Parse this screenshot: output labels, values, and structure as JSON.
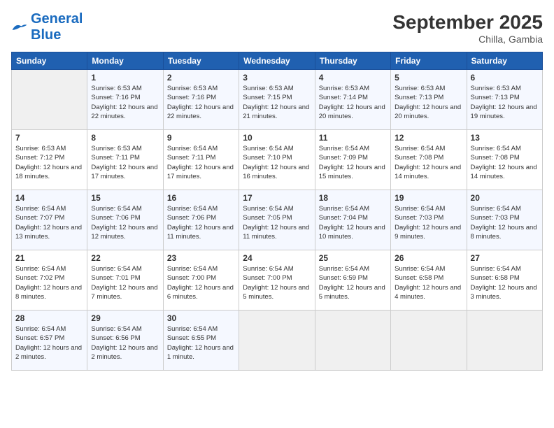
{
  "header": {
    "logo_general": "General",
    "logo_blue": "Blue",
    "title": "September 2025",
    "subtitle": "Chilla, Gambia"
  },
  "columns": [
    "Sunday",
    "Monday",
    "Tuesday",
    "Wednesday",
    "Thursday",
    "Friday",
    "Saturday"
  ],
  "weeks": [
    [
      {
        "num": "",
        "sunrise": "",
        "sunset": "",
        "daylight": "",
        "empty": true
      },
      {
        "num": "1",
        "sunrise": "Sunrise: 6:53 AM",
        "sunset": "Sunset: 7:16 PM",
        "daylight": "Daylight: 12 hours and 22 minutes."
      },
      {
        "num": "2",
        "sunrise": "Sunrise: 6:53 AM",
        "sunset": "Sunset: 7:16 PM",
        "daylight": "Daylight: 12 hours and 22 minutes."
      },
      {
        "num": "3",
        "sunrise": "Sunrise: 6:53 AM",
        "sunset": "Sunset: 7:15 PM",
        "daylight": "Daylight: 12 hours and 21 minutes."
      },
      {
        "num": "4",
        "sunrise": "Sunrise: 6:53 AM",
        "sunset": "Sunset: 7:14 PM",
        "daylight": "Daylight: 12 hours and 20 minutes."
      },
      {
        "num": "5",
        "sunrise": "Sunrise: 6:53 AM",
        "sunset": "Sunset: 7:13 PM",
        "daylight": "Daylight: 12 hours and 20 minutes."
      },
      {
        "num": "6",
        "sunrise": "Sunrise: 6:53 AM",
        "sunset": "Sunset: 7:13 PM",
        "daylight": "Daylight: 12 hours and 19 minutes."
      }
    ],
    [
      {
        "num": "7",
        "sunrise": "Sunrise: 6:53 AM",
        "sunset": "Sunset: 7:12 PM",
        "daylight": "Daylight: 12 hours and 18 minutes."
      },
      {
        "num": "8",
        "sunrise": "Sunrise: 6:53 AM",
        "sunset": "Sunset: 7:11 PM",
        "daylight": "Daylight: 12 hours and 17 minutes."
      },
      {
        "num": "9",
        "sunrise": "Sunrise: 6:54 AM",
        "sunset": "Sunset: 7:11 PM",
        "daylight": "Daylight: 12 hours and 17 minutes."
      },
      {
        "num": "10",
        "sunrise": "Sunrise: 6:54 AM",
        "sunset": "Sunset: 7:10 PM",
        "daylight": "Daylight: 12 hours and 16 minutes."
      },
      {
        "num": "11",
        "sunrise": "Sunrise: 6:54 AM",
        "sunset": "Sunset: 7:09 PM",
        "daylight": "Daylight: 12 hours and 15 minutes."
      },
      {
        "num": "12",
        "sunrise": "Sunrise: 6:54 AM",
        "sunset": "Sunset: 7:08 PM",
        "daylight": "Daylight: 12 hours and 14 minutes."
      },
      {
        "num": "13",
        "sunrise": "Sunrise: 6:54 AM",
        "sunset": "Sunset: 7:08 PM",
        "daylight": "Daylight: 12 hours and 14 minutes."
      }
    ],
    [
      {
        "num": "14",
        "sunrise": "Sunrise: 6:54 AM",
        "sunset": "Sunset: 7:07 PM",
        "daylight": "Daylight: 12 hours and 13 minutes."
      },
      {
        "num": "15",
        "sunrise": "Sunrise: 6:54 AM",
        "sunset": "Sunset: 7:06 PM",
        "daylight": "Daylight: 12 hours and 12 minutes."
      },
      {
        "num": "16",
        "sunrise": "Sunrise: 6:54 AM",
        "sunset": "Sunset: 7:06 PM",
        "daylight": "Daylight: 12 hours and 11 minutes."
      },
      {
        "num": "17",
        "sunrise": "Sunrise: 6:54 AM",
        "sunset": "Sunset: 7:05 PM",
        "daylight": "Daylight: 12 hours and 11 minutes."
      },
      {
        "num": "18",
        "sunrise": "Sunrise: 6:54 AM",
        "sunset": "Sunset: 7:04 PM",
        "daylight": "Daylight: 12 hours and 10 minutes."
      },
      {
        "num": "19",
        "sunrise": "Sunrise: 6:54 AM",
        "sunset": "Sunset: 7:03 PM",
        "daylight": "Daylight: 12 hours and 9 minutes."
      },
      {
        "num": "20",
        "sunrise": "Sunrise: 6:54 AM",
        "sunset": "Sunset: 7:03 PM",
        "daylight": "Daylight: 12 hours and 8 minutes."
      }
    ],
    [
      {
        "num": "21",
        "sunrise": "Sunrise: 6:54 AM",
        "sunset": "Sunset: 7:02 PM",
        "daylight": "Daylight: 12 hours and 8 minutes."
      },
      {
        "num": "22",
        "sunrise": "Sunrise: 6:54 AM",
        "sunset": "Sunset: 7:01 PM",
        "daylight": "Daylight: 12 hours and 7 minutes."
      },
      {
        "num": "23",
        "sunrise": "Sunrise: 6:54 AM",
        "sunset": "Sunset: 7:00 PM",
        "daylight": "Daylight: 12 hours and 6 minutes."
      },
      {
        "num": "24",
        "sunrise": "Sunrise: 6:54 AM",
        "sunset": "Sunset: 7:00 PM",
        "daylight": "Daylight: 12 hours and 5 minutes."
      },
      {
        "num": "25",
        "sunrise": "Sunrise: 6:54 AM",
        "sunset": "Sunset: 6:59 PM",
        "daylight": "Daylight: 12 hours and 5 minutes."
      },
      {
        "num": "26",
        "sunrise": "Sunrise: 6:54 AM",
        "sunset": "Sunset: 6:58 PM",
        "daylight": "Daylight: 12 hours and 4 minutes."
      },
      {
        "num": "27",
        "sunrise": "Sunrise: 6:54 AM",
        "sunset": "Sunset: 6:58 PM",
        "daylight": "Daylight: 12 hours and 3 minutes."
      }
    ],
    [
      {
        "num": "28",
        "sunrise": "Sunrise: 6:54 AM",
        "sunset": "Sunset: 6:57 PM",
        "daylight": "Daylight: 12 hours and 2 minutes."
      },
      {
        "num": "29",
        "sunrise": "Sunrise: 6:54 AM",
        "sunset": "Sunset: 6:56 PM",
        "daylight": "Daylight: 12 hours and 2 minutes."
      },
      {
        "num": "30",
        "sunrise": "Sunrise: 6:54 AM",
        "sunset": "Sunset: 6:55 PM",
        "daylight": "Daylight: 12 hours and 1 minute."
      },
      {
        "num": "",
        "sunrise": "",
        "sunset": "",
        "daylight": "",
        "empty": true
      },
      {
        "num": "",
        "sunrise": "",
        "sunset": "",
        "daylight": "",
        "empty": true
      },
      {
        "num": "",
        "sunrise": "",
        "sunset": "",
        "daylight": "",
        "empty": true
      },
      {
        "num": "",
        "sunrise": "",
        "sunset": "",
        "daylight": "",
        "empty": true
      }
    ]
  ]
}
